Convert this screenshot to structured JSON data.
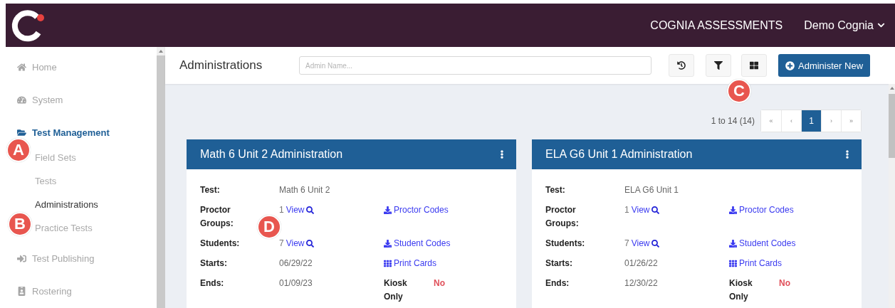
{
  "header": {
    "app_name": "COGNIA ASSESSMENTS",
    "user_menu": "Demo Cognia"
  },
  "sidebar": {
    "items": [
      {
        "label": "Home",
        "kind": "home",
        "selected": false
      },
      {
        "label": "System",
        "kind": "system",
        "selected": false
      },
      {
        "label": "Test Management",
        "kind": "folder",
        "selected": true,
        "expanded": true,
        "children": [
          {
            "label": "Field Sets",
            "selected": false
          },
          {
            "label": "Tests",
            "selected": false
          },
          {
            "label": "Administrations",
            "selected": true
          },
          {
            "label": "Practice Tests",
            "selected": false
          }
        ]
      },
      {
        "label": "Test Publishing",
        "kind": "publish",
        "selected": false
      },
      {
        "label": "Rostering",
        "kind": "roster",
        "selected": false
      }
    ]
  },
  "toolbar": {
    "title": "Administrations",
    "search": {
      "placeholder": "Admin Name..."
    },
    "primary_button": "Administer New"
  },
  "pagination": {
    "summary": "1 to 14 (14)",
    "pages": [
      {
        "label": "«",
        "selected": false
      },
      {
        "label": "‹",
        "selected": false
      },
      {
        "label": "1",
        "selected": true
      },
      {
        "label": "›",
        "selected": false
      },
      {
        "label": "»",
        "selected": false
      }
    ]
  },
  "cards": [
    {
      "title": "Math 6 Unit 2 Administration",
      "rows": [
        {
          "label": "Test:",
          "value": {
            "kind": "text",
            "text": "Math 6 Unit 2"
          }
        },
        {
          "label": "Proctor Groups:",
          "value": {
            "kind": "view",
            "count": "1",
            "text": "View"
          },
          "extra": {
            "kind": "download",
            "text": "Proctor Codes"
          }
        },
        {
          "label": "Students:",
          "value": {
            "kind": "view",
            "count": "7",
            "text": "View"
          },
          "extra": {
            "kind": "download",
            "text": "Student Codes"
          }
        },
        {
          "label": "Starts:",
          "value": {
            "kind": "text",
            "text": "06/29/22"
          },
          "extra": {
            "kind": "print",
            "text": "Print Cards"
          }
        },
        {
          "label": "Ends:",
          "value": {
            "kind": "text",
            "text": "01/09/23"
          },
          "extra": {
            "kind": "flag",
            "label": "Kiosk Only",
            "text": "No"
          }
        }
      ]
    },
    {
      "title": "ELA G6 Unit 1 Administration",
      "rows": [
        {
          "label": "Test:",
          "value": {
            "kind": "text",
            "text": "ELA G6 Unit 1"
          }
        },
        {
          "label": "Proctor Groups:",
          "value": {
            "kind": "view",
            "count": "1",
            "text": "View"
          },
          "extra": {
            "kind": "download",
            "text": "Proctor Codes"
          }
        },
        {
          "label": "Students:",
          "value": {
            "kind": "view",
            "count": "7",
            "text": "View"
          },
          "extra": {
            "kind": "download",
            "text": "Student Codes"
          }
        },
        {
          "label": "Starts:",
          "value": {
            "kind": "text",
            "text": "01/26/22"
          },
          "extra": {
            "kind": "print",
            "text": "Print Cards"
          }
        },
        {
          "label": "Ends:",
          "value": {
            "kind": "text",
            "text": "12/30/22"
          },
          "extra": {
            "kind": "flag",
            "label": "Kiosk Only",
            "text": "No"
          }
        }
      ]
    }
  ],
  "callouts": [
    {
      "label": "A"
    },
    {
      "label": "B"
    },
    {
      "label": "C"
    },
    {
      "label": "D"
    }
  ]
}
